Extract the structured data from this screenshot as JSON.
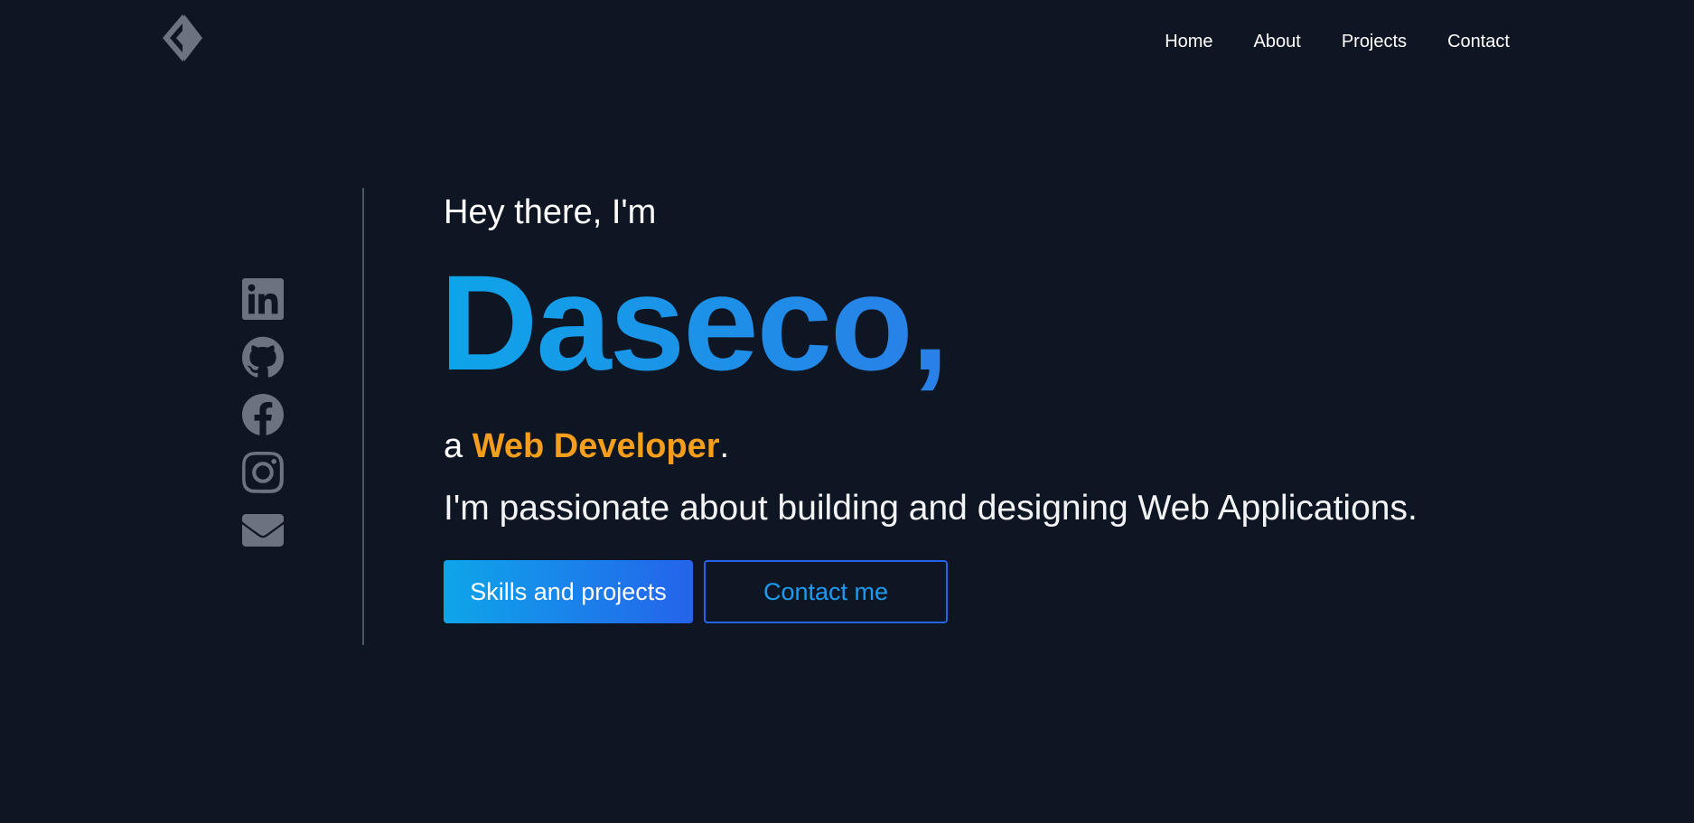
{
  "header": {
    "logo_icon": "diamond-arrow-logo-icon",
    "nav": [
      {
        "label": "Home"
      },
      {
        "label": "About"
      },
      {
        "label": "Projects"
      },
      {
        "label": "Contact"
      }
    ]
  },
  "socials": [
    {
      "icon": "linkedin-icon"
    },
    {
      "icon": "github-icon"
    },
    {
      "icon": "facebook-icon"
    },
    {
      "icon": "instagram-icon"
    },
    {
      "icon": "mail-icon"
    }
  ],
  "hero": {
    "greeting": "Hey there, I'm",
    "name": "Daseco,",
    "role_prefix": "a ",
    "role": "Web Developer",
    "role_suffix": ".",
    "tagline": "I'm passionate about building and designing Web Applications.",
    "primary_button": "Skills and projects",
    "secondary_button": "Contact me"
  },
  "colors": {
    "background": "#0f1623",
    "accent_blue": "#0ea5e9",
    "accent_orange": "#f59e1b",
    "icon_gray": "#6b7280"
  }
}
